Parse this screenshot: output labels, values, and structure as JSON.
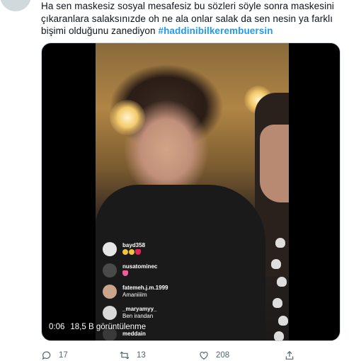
{
  "tweet": {
    "text_main": "Ha sen maskesiz sosyal mesafesiz bu sözleri söyle sonra maskesini çıkaranlara salaksınızde oh ne ala onlar salak da sen nesin ya farklı bişimi olduğunu zanediyon ",
    "hashtag": "#haddinibilkerembuersin"
  },
  "video": {
    "elapsed": "0:06",
    "views": "18,5 B görüntülenme"
  },
  "live_comments": [
    {
      "user": "bayd358",
      "message": "",
      "avatar_color": "#e6e6e6",
      "emojis": [
        "y",
        "y",
        "r"
      ]
    },
    {
      "user": "nusatominec",
      "message": "",
      "avatar_color": "#4a4a4a",
      "emojis": [
        "p"
      ]
    },
    {
      "user": "fatemeh.j.m.1999",
      "message": "Amaniiiim",
      "avatar_color": "#c9a58b",
      "emojis": []
    },
    {
      "user": "_maryamyy_",
      "message": "Ben irandan",
      "avatar_color": "#d9d9d9",
      "emojis": []
    },
    {
      "user": "meddain",
      "message": "",
      "avatar_color": "#3a3a3a",
      "emojis": []
    }
  ],
  "actions": {
    "reply_count": "17",
    "retweet_count": "13",
    "like_count": "208"
  },
  "colors": {
    "hashtag": "#1d9bf0",
    "action_gray": "#536471"
  }
}
